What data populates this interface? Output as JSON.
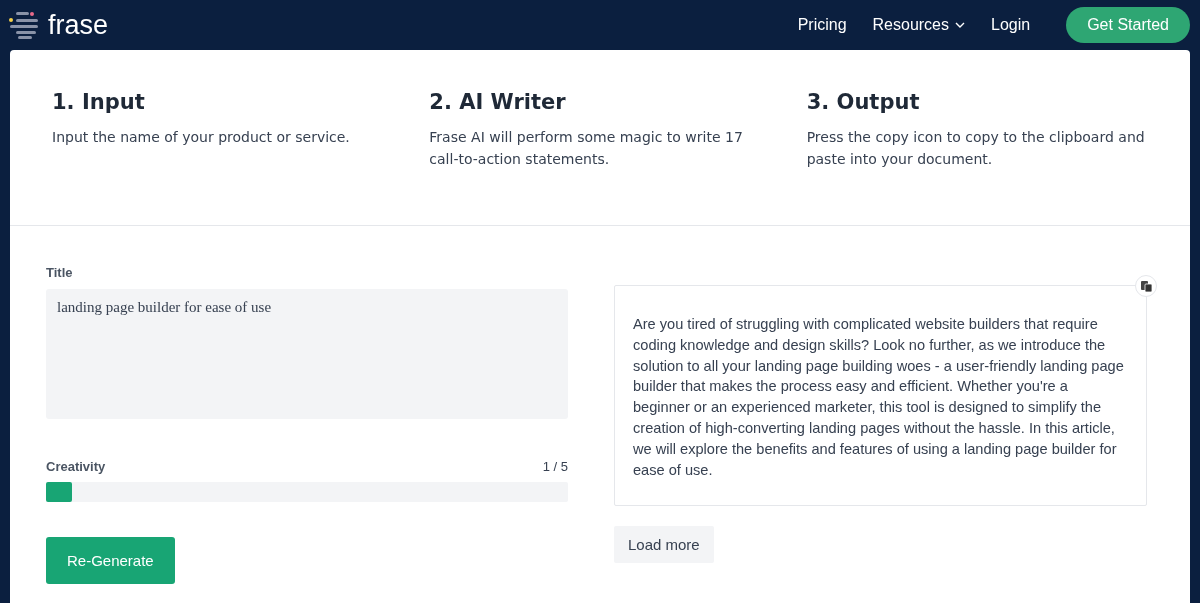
{
  "header": {
    "logo": "frase",
    "nav": [
      {
        "label": "Pricing",
        "kind": "link"
      },
      {
        "label": "Resources",
        "kind": "dropdown"
      },
      {
        "label": "Login",
        "kind": "link"
      }
    ],
    "cta": "Get Started"
  },
  "steps": [
    {
      "title": "1. Input",
      "text": "Input the name of your product or service."
    },
    {
      "title": "2. AI Writer",
      "text": "Frase AI will perform some magic to write 17 call-to-action statements."
    },
    {
      "title": "3. Output",
      "text": "Press the copy icon to copy to the clipboard and paste into your document."
    }
  ],
  "form": {
    "title_label": "Title",
    "title_value": "landing page builder for ease of use",
    "creativity": {
      "label": "Creativity",
      "reading": "1 / 5",
      "level": 0.05
    },
    "button": "Re-Generate"
  },
  "output": {
    "text": "Are you tired of struggling with complicated website builders that require coding knowledge and design skills? Look no further, as we introduce the solution to all your landing page building woes - a user-friendly landing page builder that makes the process easy and efficient. Whether you're a beginner or an experienced marketer, this tool is designed to simplify the creation of high-converting landing pages without the hassle. In this article, we will explore the benefits and features of using a landing page builder for ease of use.",
    "load_more": "Load more"
  }
}
